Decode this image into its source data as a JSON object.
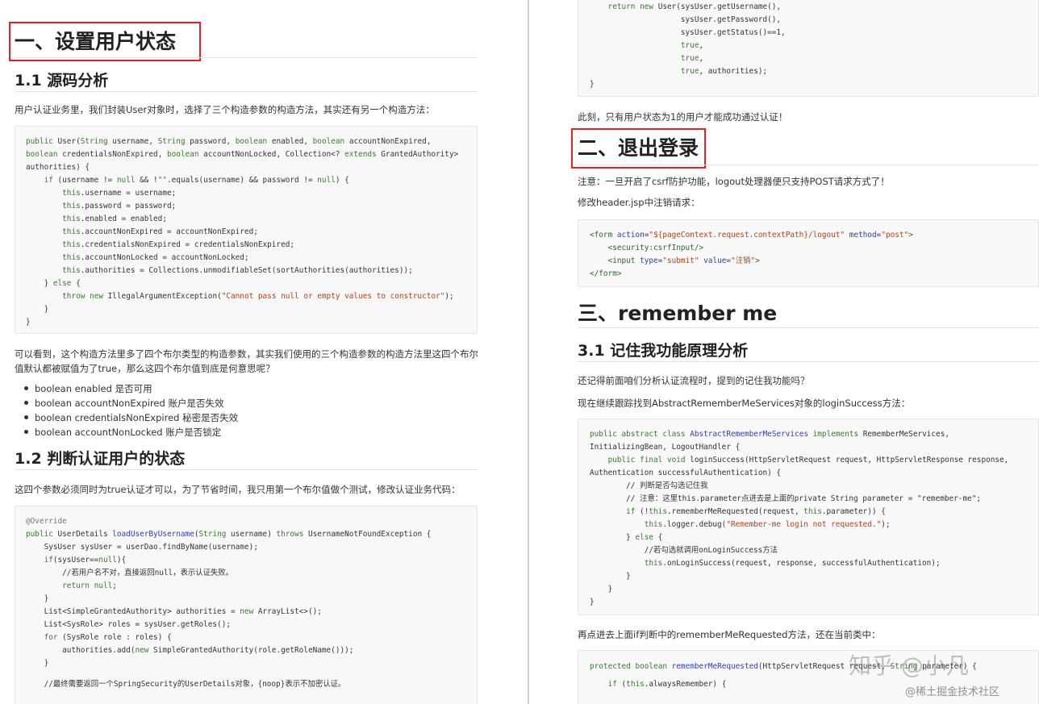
{
  "left": {
    "section1_title": "一、设置用户状态",
    "sub1_title": "1.1 源码分析",
    "para1": "用户认证业务里，我们封装User对象时，选择了三个构造参数的构造方法，其实还有另一个构造方法：",
    "code1": [
      "public User(String username, String password, boolean enabled, boolean accountNonExpired,",
      "boolean credentialsNonExpired, boolean accountNonLocked, Collection<? extends GrantedAuthority>",
      "authorities) {",
      "    if (username != null && !\"\".equals(username) && password != null) {",
      "        this.username = username;",
      "        this.password = password;",
      "        this.enabled = enabled;",
      "        this.accountNonExpired = accountNonExpired;",
      "        this.credentialsNonExpired = credentialsNonExpired;",
      "        this.accountNonLocked = accountNonLocked;",
      "        this.authorities = Collections.unmodifiableSet(sortAuthorities(authorities));",
      "    } else {",
      "        throw new IllegalArgumentException(\"Cannot pass null or empty values to constructor\");",
      "    }",
      "}"
    ],
    "para2_line1": "可以看到，这个构造方法里多了四个布尔类型的构造参数，其实我们使用的三个构造参数的构造方法里这四个布尔",
    "para2_line2": "值默认都被赋值为了true，那么这四个布尔值到底是何意思呢？",
    "bullets": [
      "boolean enabled  是否可用",
      "boolean accountNonExpired 账户是否失效",
      "boolean credentialsNonExpired 秘密是否失效",
      "boolean accountNonLocked 账户是否锁定"
    ],
    "sub2_title": "1.2 判断认证用户的状态",
    "para3": "这四个参数必须同时为true认证才可以，为了节省时间，我只用第一个布尔值做个测试，修改认证业务代码：",
    "code2": [
      "@Override",
      "public UserDetails loadUserByUsername(String username) throws UsernameNotFoundException {",
      "    SysUser sysUser = userDao.findByName(username);",
      "    if(sysUser==null){",
      "        //若用户名不对，直接返回null，表示认证失败。",
      "        return null;",
      "    }",
      "    List<SimpleGrantedAuthority> authorities = new ArrayList<>();",
      "    List<SysRole> roles = sysUser.getRoles();",
      "    for (SysRole role : roles) {",
      "        authorities.add(new SimpleGrantedAuthority(role.getRoleName()));",
      "    }",
      "",
      "    //最终需要返回一个SpringSecurity的UserDetails对象，{noop}表示不加密认证。"
    ]
  },
  "right": {
    "code_top": [
      "    return new User(sysUser.getUsername(),",
      "                    sysUser.getPassword(),",
      "                    sysUser.getStatus()==1,",
      "                    true,",
      "                    true,",
      "                    true, authorities);",
      "}"
    ],
    "para_top": "此刻，只有用户状态为1的用户才能成功通过认证！",
    "section2_title": "二、退出登录",
    "para_note": "注意：一旦开启了csrf防护功能，logout处理器便只支持POST请求方式了！",
    "para_modify": "修改header.jsp中注销请求：",
    "code_form": [
      "<form action=\"${pageContext.request.contextPath}/logout\" method=\"post\">",
      "    <security:csrfInput/>",
      "    <input type=\"submit\" value=\"注销\">",
      "</form>"
    ],
    "section3_title": "三、remember me",
    "sub31_title": "3.1 记住我功能原理分析",
    "para_q": "还记得前面咱们分析认证流程时，提到的记住我功能吗？",
    "para_track": "现在继续跟踪找到AbstractRememberMeServices对象的loginSuccess方法：",
    "code_rm": [
      "public abstract class AbstractRememberMeServices implements RememberMeServices,",
      "InitializingBean, LogoutHandler {",
      "    public final void loginSuccess(HttpServletRequest request, HttpServletResponse response,",
      "Authentication successfulAuthentication) {",
      "        // 判断是否勾选记住我",
      "        // 注意：这里this.parameter点进去是上面的private String parameter = \"remember-me\";",
      "        if (!this.rememberMeRequested(request, this.parameter)) {",
      "            this.logger.debug(\"Remember-me login not requested.\");",
      "        } else {",
      "            //若勾选就调用onLoginSuccess方法",
      "            this.onLoginSuccess(request, response, successfulAuthentication);",
      "        }",
      "    }",
      "}"
    ],
    "para_next": "再点进去上面if判断中的rememberMeRequested方法，还在当前类中：",
    "code_last": [
      "protected boolean rememberMeRequested(HttpServletRequest request, String parameter) {",
      "    if (this.alwaysRemember) {"
    ],
    "watermark_main": "知乎 @小凡",
    "watermark_sub": "@稀土掘金技术社区"
  }
}
